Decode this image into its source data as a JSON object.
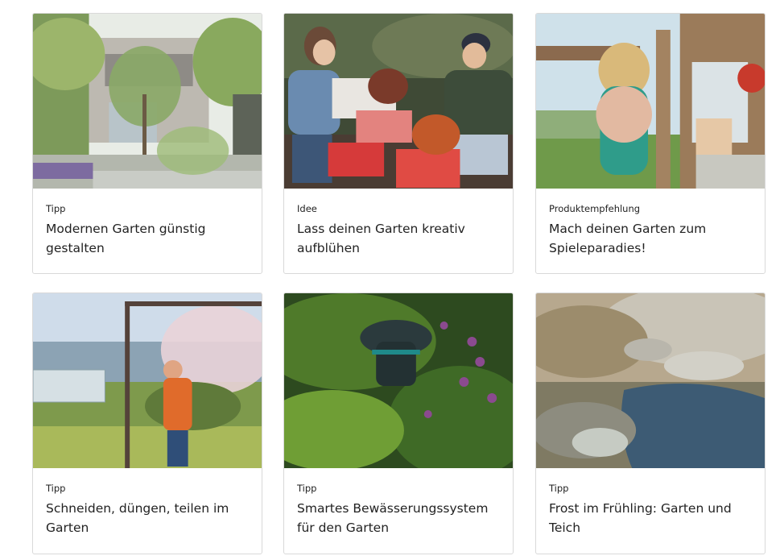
{
  "cards": [
    {
      "category": "Tipp",
      "title": "Modernen Garten günstig gestalten",
      "image": "modern-garden-house"
    },
    {
      "category": "Idee",
      "title": "Lass deinen Garten kreativ aufblühen",
      "image": "couple-planting-crates"
    },
    {
      "category": "Produktempfehlung",
      "title": "Mach deinen Garten zum Spieleparadies!",
      "image": "kids-playhouse-swing"
    },
    {
      "category": "Tipp",
      "title": "Schneiden, düngen, teilen im Garten",
      "image": "gardener-pruning-tree"
    },
    {
      "category": "Tipp",
      "title": "Smartes Bewässerungssystem für den Garten",
      "image": "smart-sensor-lavender"
    },
    {
      "category": "Tipp",
      "title": "Frost im Frühling: Garten und Teich",
      "image": "frozen-pond"
    }
  ]
}
